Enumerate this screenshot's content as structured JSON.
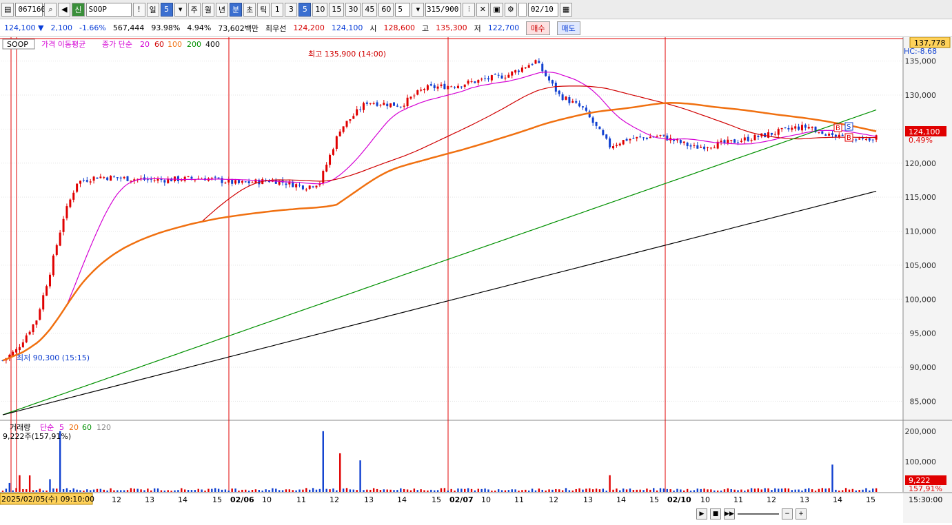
{
  "toolbar": {
    "code": "067160",
    "name_badge": "신",
    "stock_name": "SOOP",
    "period_day": "일",
    "period_interval": "5",
    "period_week": "주",
    "period_month": "월",
    "period_year": "년",
    "period_minute": "분",
    "period_second": "초",
    "period_tick": "틱",
    "intervals": [
      "1",
      "3",
      "5",
      "10",
      "15",
      "30",
      "45",
      "60"
    ],
    "interval_input": "5",
    "count": "315/900",
    "date": "02/10"
  },
  "quote": {
    "price": "124,100",
    "change": "2,100",
    "change_pct": "-1.66%",
    "volume": "567,444",
    "vol_ratio": "93.98%",
    "turnover": "4.94%",
    "amount": "73,602백만",
    "best_label": "최우선",
    "best_ask": "124,200",
    "best_bid": "124,100",
    "open_label": "시",
    "open": "128,600",
    "high_label": "고",
    "high": "135,300",
    "low_label": "저",
    "low": "122,700",
    "buy": "매수",
    "sell": "매도"
  },
  "legend": {
    "name": "SOOP",
    "title": "가격 이동평균",
    "type": "종가 단순",
    "periods": [
      "20",
      "60",
      "100",
      "200",
      "400"
    ],
    "period_colors": [
      "#d400d4",
      "#d00000",
      "#f07010",
      "#009000",
      "#000000"
    ]
  },
  "annotations": {
    "high": "최고 135,900 (14:00)",
    "low": "최저 90,300 (15:15)",
    "hc": "HC:-8.68",
    "price_box": "124,100",
    "price_pct": "0.49%",
    "top_box": "137,778"
  },
  "vol_legend": {
    "name": "거래량",
    "type": "단순",
    "periods": [
      "5",
      "20",
      "60",
      "120"
    ],
    "value": "9,222주(157,91%)",
    "box": "9,222",
    "pct": "157,91%"
  },
  "x_axis": {
    "start": "2025/02/05(수) 09:10:00",
    "labels": [
      "12",
      "13",
      "14",
      "15",
      "02/06",
      "10",
      "11",
      "12",
      "13",
      "14",
      "15",
      "02/07",
      "10",
      "11",
      "12",
      "13",
      "14",
      "15",
      "02/10",
      "10",
      "11",
      "12",
      "13",
      "14",
      "15"
    ],
    "time": "15:30:00"
  },
  "y_axis": {
    "labels": [
      "135,000",
      "130,000",
      "125,000",
      "120,000",
      "115,000",
      "110,000",
      "105,000",
      "100,000",
      "95,000",
      "90,000",
      "85,000"
    ],
    "vol_labels": [
      "200,000",
      "100,000"
    ]
  },
  "markers": [
    "B",
    "S",
    "B"
  ],
  "chart_data": {
    "type": "candlestick",
    "title": "SOOP",
    "ylim": [
      82000,
      138000
    ],
    "series_names": [
      "20",
      "60",
      "100",
      "200",
      "400"
    ],
    "price_range": {
      "high": 135900,
      "low": 90300,
      "last": 124100
    }
  }
}
